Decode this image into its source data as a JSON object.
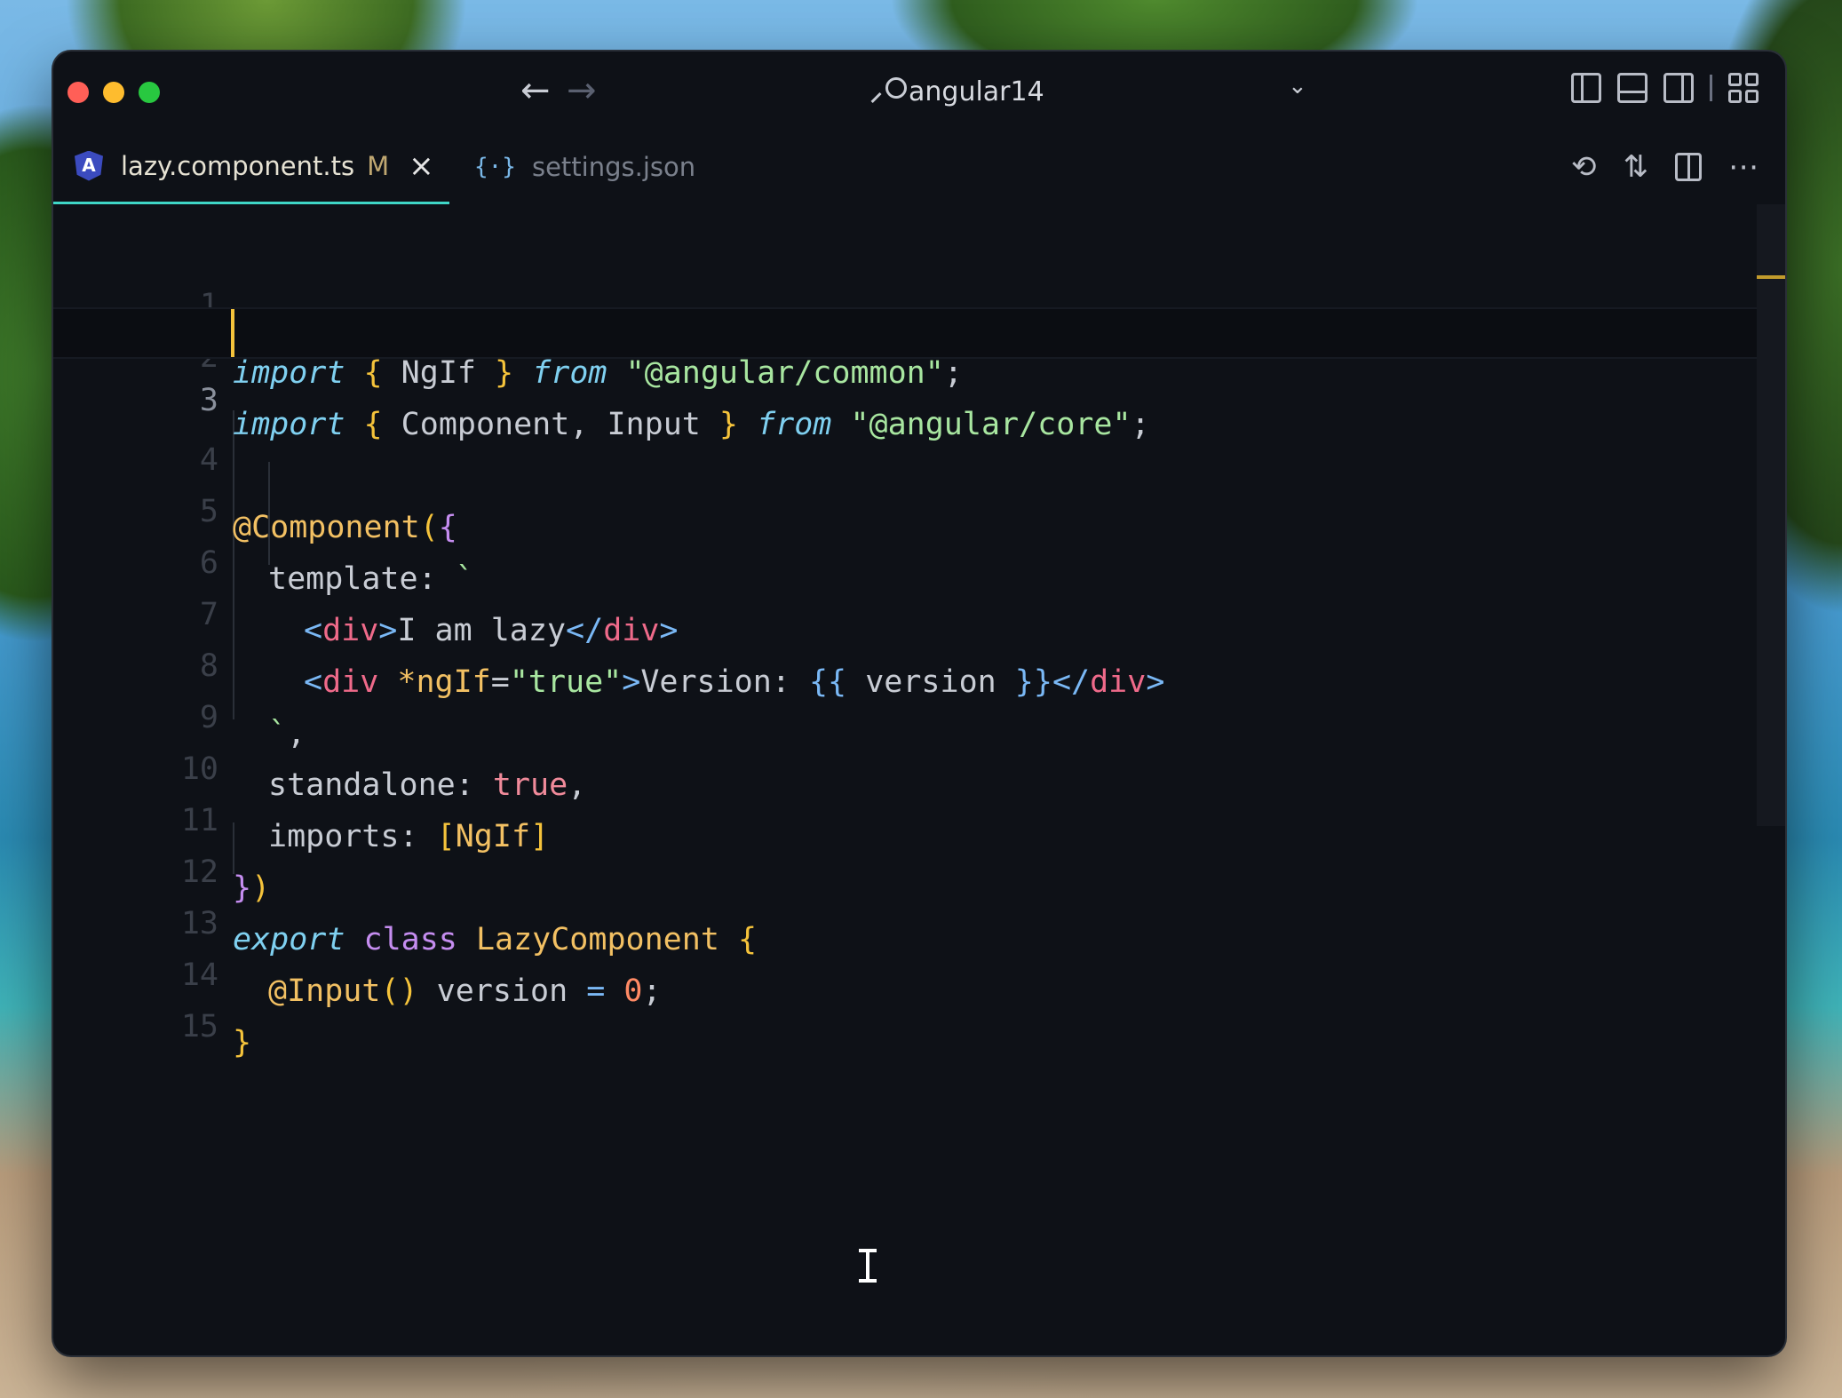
{
  "window": {
    "search_text": "angular14"
  },
  "tabs": [
    {
      "label": "lazy.component.ts",
      "badge": "M",
      "active": true
    },
    {
      "label": "settings.json",
      "active": false
    }
  ],
  "line_numbers": [
    "1",
    "2",
    "3",
    "4",
    "5",
    "6",
    "7",
    "8",
    "9",
    "10",
    "11",
    "12",
    "13",
    "14",
    "15"
  ],
  "code": {
    "l1": {
      "import": "import",
      "ob": "{",
      "name": "NgIf",
      "cb": "}",
      "from": "from",
      "path": "\"@angular/common\"",
      "semi": ";"
    },
    "l2": {
      "import": "import",
      "ob": "{",
      "a": "Component",
      "comma": ",",
      "b": "Input",
      "cb": "}",
      "from": "from",
      "path": "\"@angular/core\"",
      "semi": ";"
    },
    "l4": {
      "dec": "@Component",
      "paren": "(",
      "ob": "{"
    },
    "l5": {
      "key": "template:",
      "tick": "`"
    },
    "l6": {
      "lt": "<",
      "tag": "div",
      "gt": ">",
      "text": "I am lazy",
      "lt2": "</",
      "tag2": "div",
      "gt2": ">"
    },
    "l7": {
      "lt": "<",
      "tag": "div",
      "attr": "*ngIf",
      "eq": "=",
      "val": "\"true\"",
      "gt": ">",
      "text": "Version: ",
      "ob": "{{",
      "var": " version ",
      "cb": "}}",
      "lt2": "</",
      "tag2": "div",
      "gt2": ">"
    },
    "l8": {
      "tick": "`",
      "comma": ","
    },
    "l9": {
      "key": "standalone:",
      "val": "true",
      "comma": ","
    },
    "l10": {
      "key": "imports:",
      "ob": "[",
      "val": "NgIf",
      "cb": "]"
    },
    "l11": {
      "cb": "}",
      "paren": ")"
    },
    "l12": {
      "export": "export",
      "class": "class",
      "name": "LazyComponent",
      "ob": "{"
    },
    "l13": {
      "dec": "@Input",
      "parens": "()",
      "var": "version",
      "eq": "=",
      "num": "0",
      "semi": ";"
    },
    "l14": {
      "cb": "}"
    }
  }
}
